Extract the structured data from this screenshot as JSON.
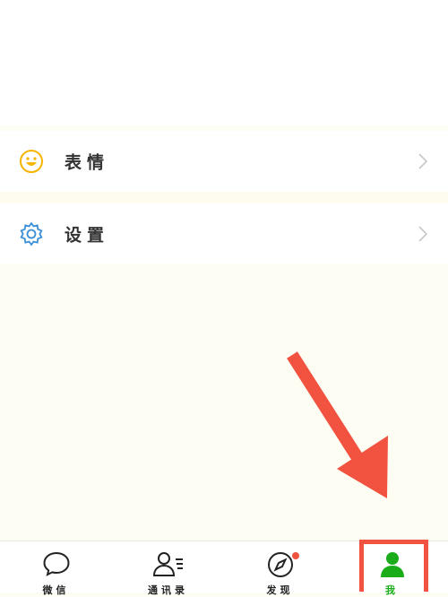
{
  "menu": {
    "items": [
      {
        "label": "表情",
        "icon": "smiley-icon"
      },
      {
        "label": "设置",
        "icon": "gear-icon"
      }
    ]
  },
  "tabbar": {
    "tabs": [
      {
        "label": "微信",
        "icon": "chat-bubble-icon"
      },
      {
        "label": "通讯录",
        "icon": "contacts-icon"
      },
      {
        "label": "发现",
        "icon": "compass-icon"
      },
      {
        "label": "我",
        "icon": "person-icon",
        "active": true
      }
    ]
  },
  "colors": {
    "accent_green": "#1aad19",
    "annotation_red": "#f25240",
    "smiley_yellow": "#f5b400",
    "gear_blue": "#3a8fd6"
  }
}
